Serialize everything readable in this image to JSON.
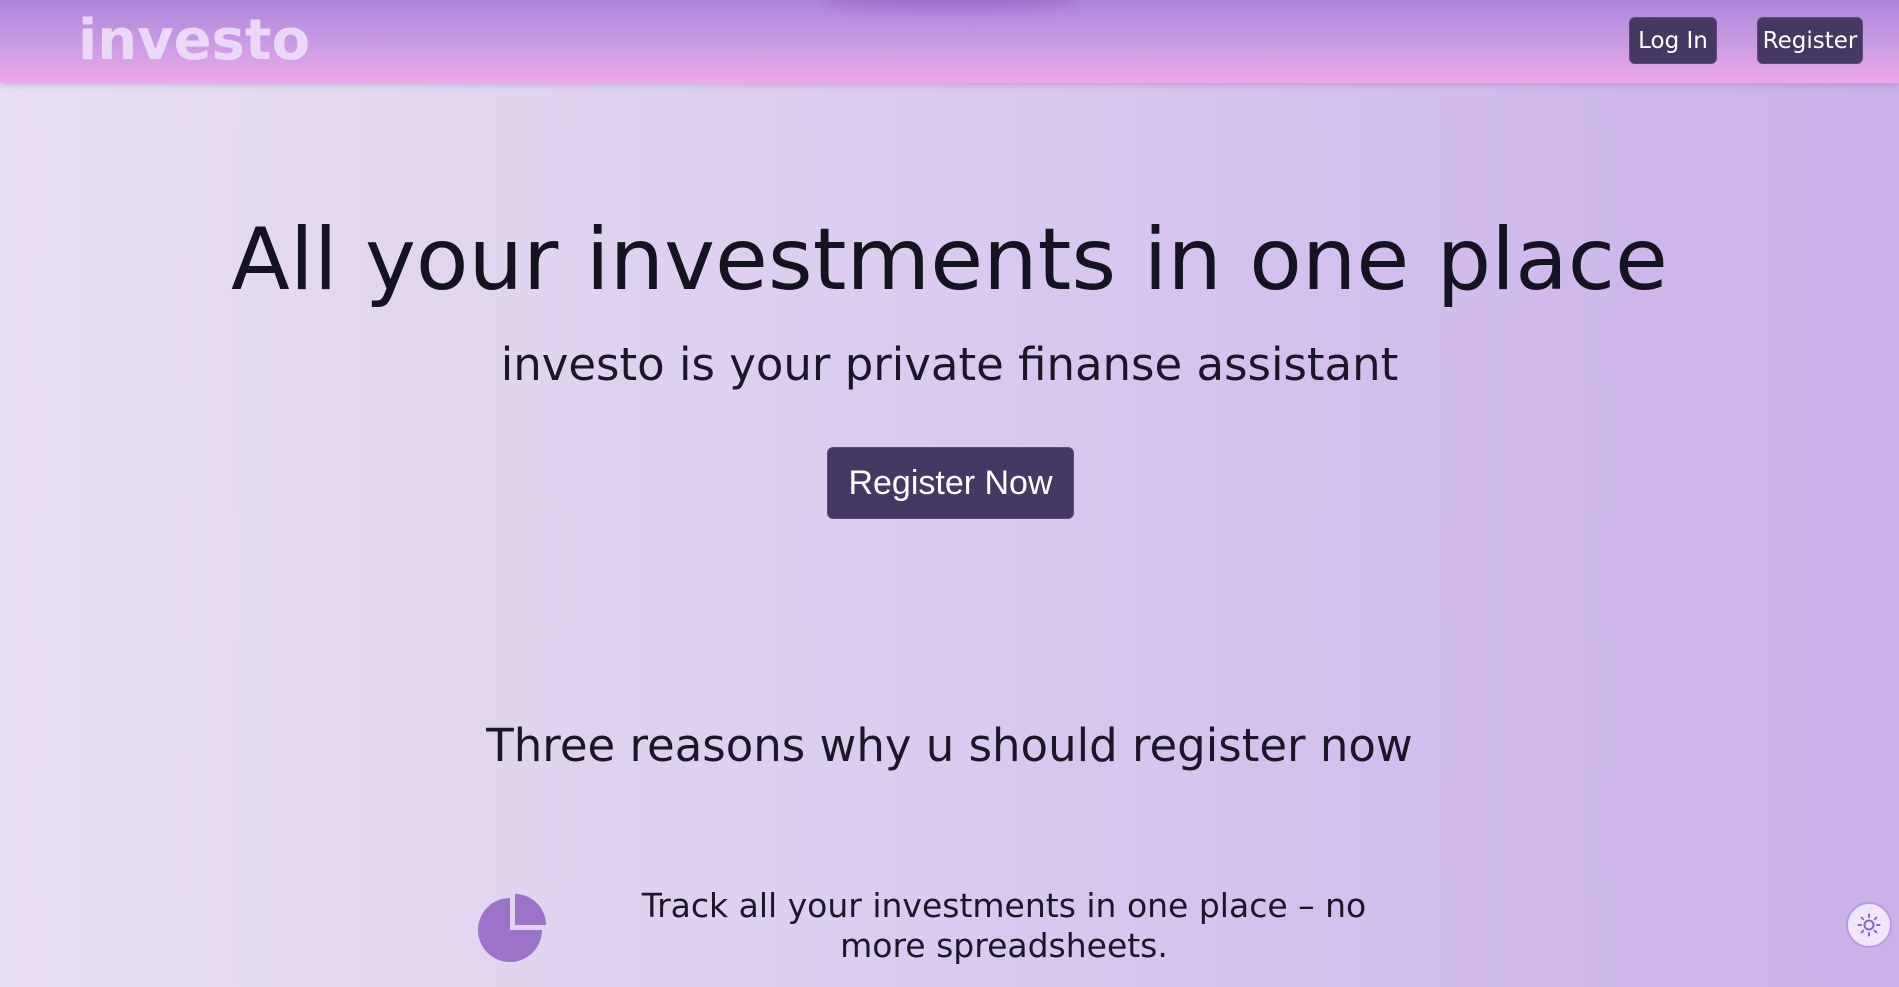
{
  "header": {
    "brand": "investo",
    "login_label": "Log In",
    "register_label": "Register"
  },
  "hero": {
    "title": "All your investments in one place",
    "subtitle": "investo is your private finanse assistant",
    "cta_label": "Register Now"
  },
  "reasons": {
    "title": "Three reasons why u should register now",
    "items": [
      {
        "icon": "pie-chart-icon",
        "text": "Track all your investments in one place – no more spreadsheets."
      }
    ]
  },
  "theme_toggle": {
    "icon": "sun-icon"
  },
  "colors": {
    "accent_button": "#453862",
    "icon_purple": "#9b74c9",
    "brand_text": "#ead9f6"
  }
}
